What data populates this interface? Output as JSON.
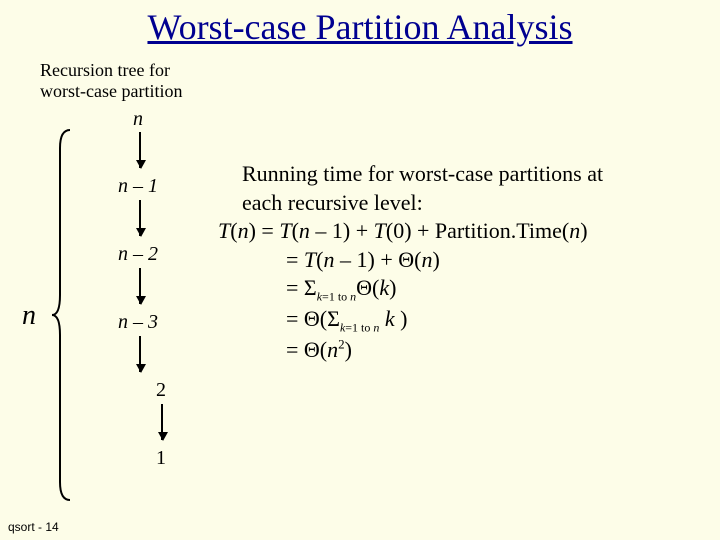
{
  "title": "Worst-case Partition Analysis",
  "subtitle_line1": "Recursion tree for",
  "subtitle_line2": "worst-case partition",
  "tree": {
    "nodes": [
      "n",
      "n – 1",
      "n – 2",
      "n – 3",
      "2",
      "1"
    ],
    "height_label": "n"
  },
  "body": {
    "intro1": "Running time for worst-case partitions at",
    "intro2": "each recursive level:",
    "line1_pre": "T",
    "line1_mid": "(",
    "line1_n": "n",
    "line1_post": ") = ",
    "line1_rhs_a": "T",
    "line1_rhs_b": "(",
    "line1_rhs_c": "n",
    "line1_rhs_d": " – 1) + ",
    "line1_rhs_e": "T",
    "line1_rhs_f": "(0) + Partition.Time(",
    "line1_rhs_g": "n",
    "line1_rhs_h": ")",
    "line2_pre": "= ",
    "line2_a": "T",
    "line2_b": "(",
    "line2_c": "n",
    "line2_d": " – 1) + Θ(",
    "line2_e": "n",
    "line2_f": ")",
    "line3_pre": "= Σ",
    "line3_sub_a": "k",
    "line3_sub_b": "=1 to ",
    "line3_sub_c": "n",
    "line3_mid": "Θ(",
    "line3_k": "k",
    "line3_end": ")",
    "line4_pre": "= Θ(Σ",
    "line4_sub_a": "k",
    "line4_sub_b": "=1 to ",
    "line4_sub_c": "n",
    "line4_sp": " ",
    "line4_k": "k",
    "line4_end": " )",
    "line5_pre": "= Θ(",
    "line5_n": "n",
    "line5_sup": "2",
    "line5_end": ")"
  },
  "footer": "qsort - 14"
}
